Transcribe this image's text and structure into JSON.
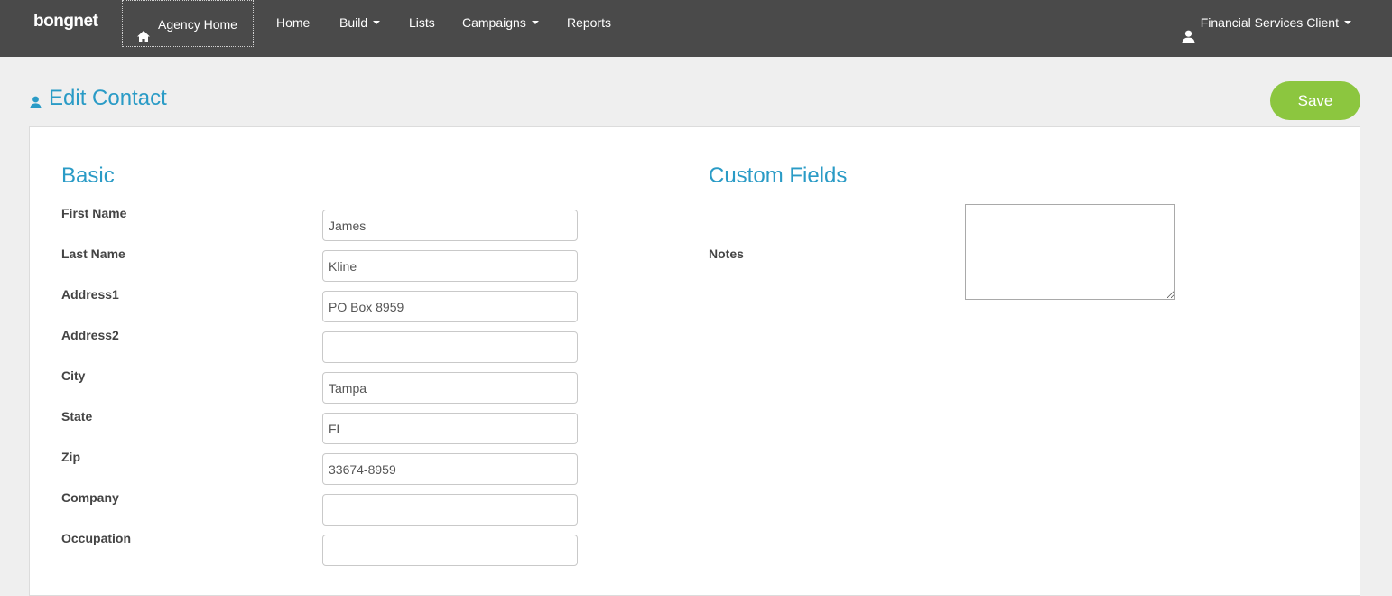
{
  "brand": {
    "name": "bongnet"
  },
  "nav": {
    "agency_home": "Agency Home",
    "items": [
      {
        "label": "Home",
        "dropdown": false
      },
      {
        "label": "Build",
        "dropdown": true
      },
      {
        "label": "Lists",
        "dropdown": false
      },
      {
        "label": "Campaigns",
        "dropdown": true
      },
      {
        "label": "Reports",
        "dropdown": false
      }
    ],
    "user_menu": "Financial Services Client"
  },
  "page": {
    "title": "Edit Contact",
    "save_label": "Save"
  },
  "basic": {
    "title": "Basic",
    "fields": [
      {
        "label": "First Name",
        "value": "James"
      },
      {
        "label": "Last Name",
        "value": "Kline"
      },
      {
        "label": "Address1",
        "value": "PO Box 8959"
      },
      {
        "label": "Address2",
        "value": ""
      },
      {
        "label": "City",
        "value": "Tampa"
      },
      {
        "label": "State",
        "value": "FL"
      },
      {
        "label": "Zip",
        "value": "33674-8959"
      },
      {
        "label": "Company",
        "value": ""
      },
      {
        "label": "Occupation",
        "value": ""
      }
    ]
  },
  "custom": {
    "title": "Custom Fields",
    "notes_label": "Notes",
    "notes_value": ""
  },
  "colors": {
    "navbar": "#4a4a4a",
    "accent": "#2a9bc6",
    "save": "#8cc63f"
  }
}
